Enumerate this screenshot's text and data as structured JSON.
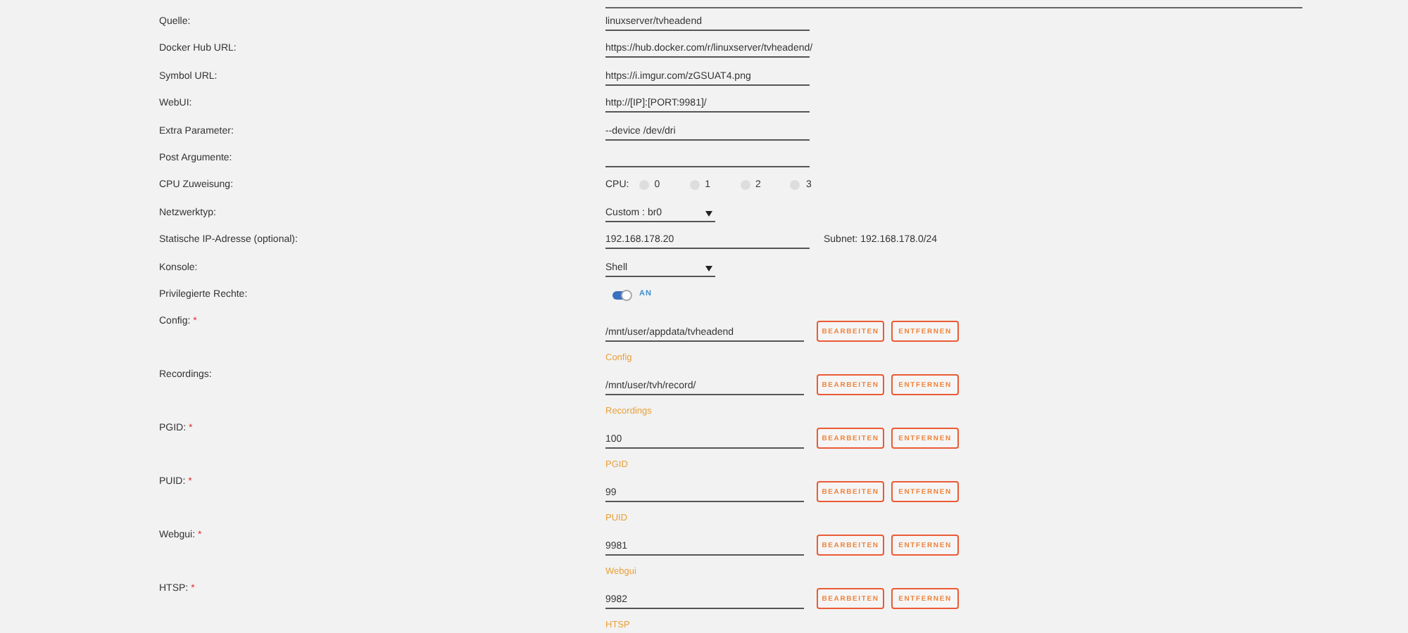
{
  "settings": [
    {
      "kind": "text",
      "label": "Quelle:",
      "value": "linuxserver/tvheadend"
    },
    {
      "kind": "text",
      "label": "Docker Hub URL:",
      "value": "https://hub.docker.com/r/linuxserver/tvheadend/"
    },
    {
      "kind": "text",
      "label": "Symbol URL:",
      "value": "https://i.imgur.com/zGSUAT4.png"
    },
    {
      "kind": "text",
      "label": "WebUI:",
      "value": "http://[IP]:[PORT:9981]/"
    },
    {
      "kind": "text",
      "label": "Extra Parameter:",
      "value": "--device /dev/dri"
    },
    {
      "kind": "text",
      "label": "Post Argumente:"
    },
    {
      "kind": "cpu",
      "label": "CPU Zuweisung:",
      "prefix": "CPU:",
      "cores": [
        {
          "label": "0",
          "checked": false
        },
        {
          "label": "1",
          "checked": false
        },
        {
          "label": "2",
          "checked": false
        },
        {
          "label": "3",
          "checked": false
        }
      ]
    },
    {
      "kind": "select",
      "label": "Netzwerktyp:",
      "value": "Custom : br0"
    },
    {
      "kind": "ip",
      "label": "Statische IP-Adresse (optional):",
      "value": "192.168.178.20",
      "note": "Subnet: 192.168.178.0/24"
    },
    {
      "kind": "select",
      "label": "Konsole:",
      "value": "Shell"
    },
    {
      "kind": "toggle",
      "label": "Privilegierte Rechte:",
      "on": true,
      "state_text": "AN"
    }
  ],
  "mappings": [
    {
      "label": "Config:",
      "marker": "*",
      "value": "/mnt/user/appdata/tvheadend",
      "description": "Config",
      "edit": "BEARBEITEN",
      "remove": "ENTFERNEN"
    },
    {
      "label": "Recordings:",
      "value": "/mnt/user/tvh/record/",
      "description": "Recordings",
      "edit": "BEARBEITEN",
      "remove": "ENTFERNEN"
    },
    {
      "label": "PGID:",
      "marker": "*",
      "value": "100",
      "description": "PGID",
      "edit": "BEARBEITEN",
      "remove": "ENTFERNEN"
    },
    {
      "label": "PUID:",
      "marker": "*",
      "value": "99",
      "description": "PUID",
      "edit": "BEARBEITEN",
      "remove": "ENTFERNEN"
    },
    {
      "label": "Webgui:",
      "marker": "*",
      "value": "9981",
      "description": "Webgui",
      "edit": "BEARBEITEN",
      "remove": "ENTFERNEN"
    },
    {
      "label": "HTSP:",
      "marker": "*",
      "value": "9982",
      "description": "HTSP",
      "edit": "BEARBEITEN",
      "remove": "ENTFERNEN"
    }
  ]
}
